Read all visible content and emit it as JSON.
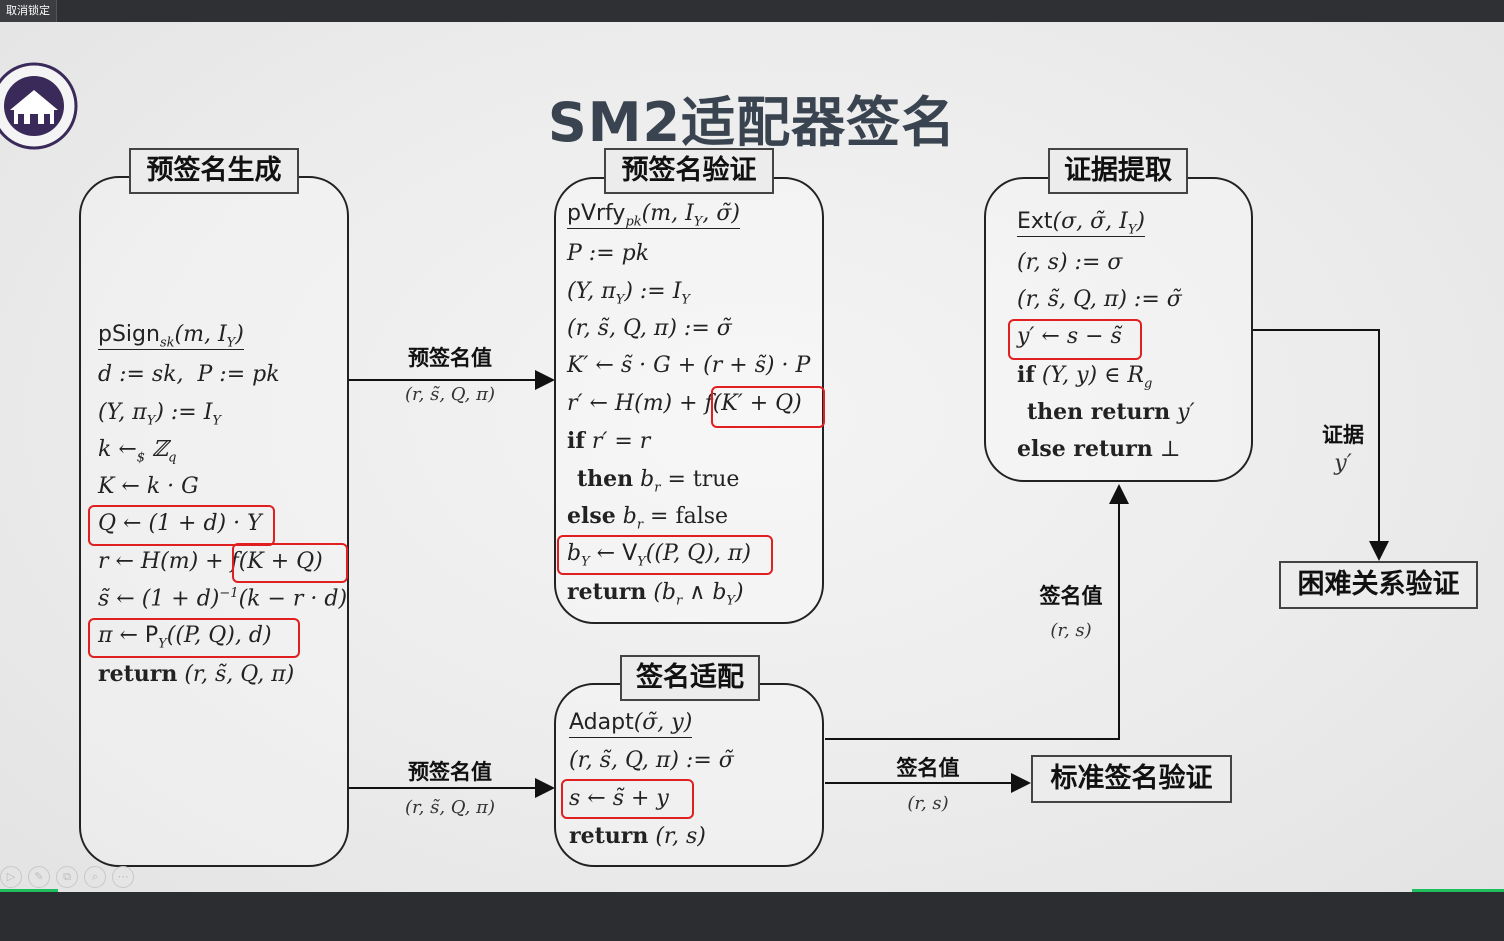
{
  "toolbar": {
    "unlock_label": "取消锁定"
  },
  "slide": {
    "title": "SM2适配器签名",
    "boxes": {
      "presign": {
        "label": "预签名生成",
        "lines": [
          "pSign_sk(m, I_Y)",
          "d := sk,  P := pk",
          "(Y, π_Y) := I_Y",
          "k ←$ Z_q",
          "K ← k · G",
          "Q ← (1 + d) · Y",
          "r ← H(m) + f(K + Q)",
          "s̃ ← (1 + d)^−1(k − r · d)",
          "π ← P_Y((P, Q), d)",
          "return (r, s̃, Q, π)"
        ]
      },
      "preverify": {
        "label": "预签名验证",
        "lines": [
          "pVrfy_pk(m, I_Y, σ̃)",
          "P := pk",
          "(Y, π_Y) := I_Y",
          "(r, s̃, Q, π) := σ̃",
          "K′ ← s̃ · G + (r + s̃) · P",
          "r′ ← H(m) + f(K′ + Q)",
          "if r′ = r",
          "then b_r = true",
          "else b_r = false",
          "b_Y ← V_Y((P, Q), π)",
          "return (b_r ∧ b_Y)"
        ]
      },
      "extract": {
        "label": "证据提取",
        "lines": [
          "Ext(σ, σ̃, I_Y)",
          "(r, s) := σ",
          "(r, s̃, Q, π) := σ̃",
          "y′ ← s − s̃",
          "if (Y, y) ∈ R_g",
          "then return y′",
          "else return ⊥"
        ]
      },
      "adapt": {
        "label": "签名适配",
        "lines": [
          "Adapt(σ̃, y)",
          "(r, s̃, Q, π) := σ̃",
          "s ← s̃ + y",
          "return (r, s)"
        ]
      },
      "hard_relation": {
        "label": "困难关系验证"
      },
      "std_verify": {
        "label": "标准签名验证"
      }
    },
    "edges": {
      "presig_top": {
        "label": "预签名值",
        "value": "(r, s̃, Q, π)"
      },
      "presig_bottom": {
        "label": "预签名值",
        "value": "(r, s̃, Q, π)"
      },
      "sig_to_verify": {
        "label": "签名值",
        "value": "(r, s)"
      },
      "sig_to_extract": {
        "label": "签名值",
        "value": "(r, s)"
      },
      "witness": {
        "label": "证据",
        "value": "y′"
      }
    }
  },
  "colors": {
    "highlight": "#e02020",
    "accent_green": "#1fbf5f",
    "title": "#3a4450"
  }
}
